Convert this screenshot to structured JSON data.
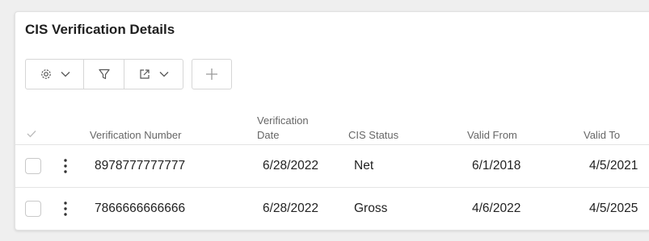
{
  "panel": {
    "title": "CIS Verification Details"
  },
  "toolbar": {
    "settings_icon": "gear-icon",
    "filter_icon": "filter-icon",
    "export_icon": "export-icon",
    "add_icon": "plus-icon"
  },
  "table": {
    "columns": [
      "Verification Number",
      "Verification Date",
      "CIS Status",
      "Valid From",
      "Valid To"
    ],
    "header_top_line": "Verification",
    "header_bottom_line": "Date",
    "rows": [
      {
        "verification_number": "8978777777777",
        "verification_date": "6/28/2022",
        "cis_status": "Net",
        "valid_from": "6/1/2018",
        "valid_to": "4/5/2021"
      },
      {
        "verification_number": "7866666666666",
        "verification_date": "6/28/2022",
        "cis_status": "Gross",
        "valid_from": "4/6/2022",
        "valid_to": "4/5/2025"
      }
    ]
  },
  "colors": {
    "accent_text": "#1f1f1f",
    "border": "#d6d6d6",
    "muted_text": "#666666"
  }
}
